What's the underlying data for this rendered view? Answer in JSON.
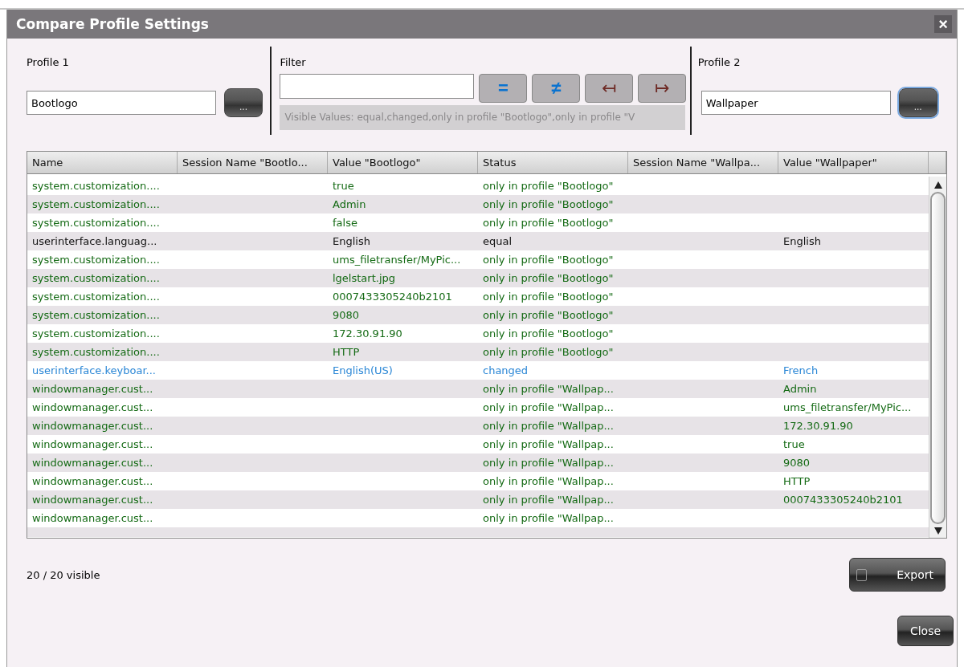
{
  "window": {
    "title": "Compare Profile Settings",
    "close": "×"
  },
  "profile1": {
    "label": "Profile 1",
    "value": "Bootlogo",
    "browse": "..."
  },
  "filter": {
    "label": "Filter",
    "buttons": [
      {
        "label": "=",
        "kind": "equal"
      },
      {
        "label": "≠",
        "kind": "changed"
      },
      {
        "label": "↤",
        "kind": "only"
      },
      {
        "label": "↦",
        "kind": "only"
      }
    ],
    "visible_values": "Visible Values: equal,changed,only in profile \"Bootlogo\",only in profile \"V"
  },
  "profile2": {
    "label": "Profile 2",
    "value": "Wallpaper",
    "browse": "...",
    "focused": true
  },
  "table": {
    "columns": [
      "Name",
      "Session Name \"Bootlo...",
      "Value \"Bootlogo\"",
      "Status",
      "Session Name \"Wallpa...",
      "Value \"Wallpaper\""
    ],
    "rows": [
      {
        "kind": "only",
        "cells": [
          "system.customization....",
          "",
          "true",
          "only in profile \"Bootlogo\"",
          "",
          ""
        ]
      },
      {
        "kind": "only",
        "cells": [
          "system.customization....",
          "",
          "Admin",
          "only in profile \"Bootlogo\"",
          "",
          ""
        ]
      },
      {
        "kind": "only",
        "cells": [
          "system.customization....",
          "",
          "false",
          "only in profile \"Bootlogo\"",
          "",
          ""
        ]
      },
      {
        "kind": "equal",
        "cells": [
          "userinterface.languag...",
          "",
          "English",
          "equal",
          "",
          "English"
        ]
      },
      {
        "kind": "only",
        "cells": [
          "system.customization....",
          "",
          "ums_filetransfer/MyPic...",
          "only in profile \"Bootlogo\"",
          "",
          ""
        ]
      },
      {
        "kind": "only",
        "cells": [
          "system.customization....",
          "",
          "lgelstart.jpg",
          "only in profile \"Bootlogo\"",
          "",
          ""
        ]
      },
      {
        "kind": "only",
        "cells": [
          "system.customization....",
          "",
          "0007433305240b2101",
          "only in profile \"Bootlogo\"",
          "",
          ""
        ]
      },
      {
        "kind": "only",
        "cells": [
          "system.customization....",
          "",
          "9080",
          "only in profile \"Bootlogo\"",
          "",
          ""
        ]
      },
      {
        "kind": "only",
        "cells": [
          "system.customization....",
          "",
          "172.30.91.90",
          "only in profile \"Bootlogo\"",
          "",
          ""
        ]
      },
      {
        "kind": "only",
        "cells": [
          "system.customization....",
          "",
          "HTTP",
          "only in profile \"Bootlogo\"",
          "",
          ""
        ]
      },
      {
        "kind": "changed",
        "cells": [
          "userinterface.keyboar...",
          "",
          "English(US)",
          "changed",
          "",
          "French"
        ]
      },
      {
        "kind": "only",
        "cells": [
          "windowmanager.cust...",
          "",
          "",
          "only in profile \"Wallpap...",
          "",
          "Admin"
        ]
      },
      {
        "kind": "only",
        "cells": [
          "windowmanager.cust...",
          "",
          "",
          "only in profile \"Wallpap...",
          "",
          "ums_filetransfer/MyPic..."
        ]
      },
      {
        "kind": "only",
        "cells": [
          "windowmanager.cust...",
          "",
          "",
          "only in profile \"Wallpap...",
          "",
          "172.30.91.90"
        ]
      },
      {
        "kind": "only",
        "cells": [
          "windowmanager.cust...",
          "",
          "",
          "only in profile \"Wallpap...",
          "",
          "true"
        ]
      },
      {
        "kind": "only",
        "cells": [
          "windowmanager.cust...",
          "",
          "",
          "only in profile \"Wallpap...",
          "",
          "9080"
        ]
      },
      {
        "kind": "only",
        "cells": [
          "windowmanager.cust...",
          "",
          "",
          "only in profile \"Wallpap...",
          "",
          "HTTP"
        ]
      },
      {
        "kind": "only",
        "cells": [
          "windowmanager.cust...",
          "",
          "",
          "only in profile \"Wallpap...",
          "",
          "0007433305240b2101"
        ]
      },
      {
        "kind": "only",
        "cells": [
          "windowmanager.cust...",
          "",
          "",
          "only in profile \"Wallpap...",
          "",
          ""
        ]
      }
    ]
  },
  "visible_count": "20 / 20 visible",
  "buttons": {
    "export": "Export",
    "close": "Close"
  }
}
